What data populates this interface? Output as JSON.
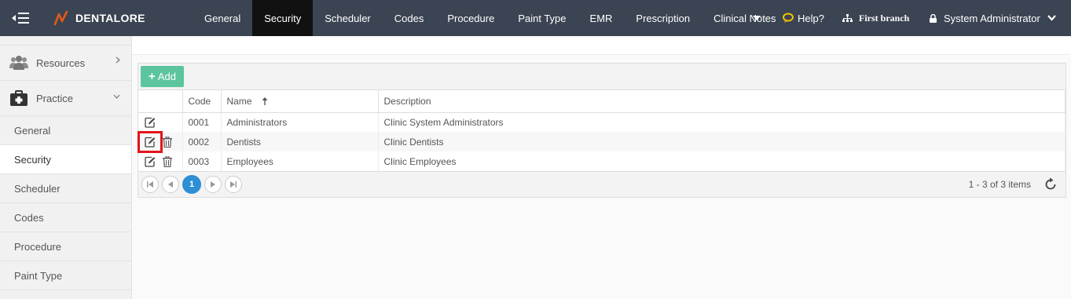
{
  "app": {
    "name": "DENTALORE"
  },
  "nav": {
    "items": [
      "General",
      "Security",
      "Scheduler",
      "Codes",
      "Procedure",
      "Paint Type",
      "EMR",
      "Prescription",
      "Clinical Notes"
    ],
    "active": "Security",
    "help": "Help?",
    "branch": "First branch",
    "user": "System Administrator"
  },
  "sidebar": {
    "groups": [
      {
        "label": "Resources",
        "icon": "users-icon"
      },
      {
        "label": "Practice",
        "icon": "medical-kit-icon"
      }
    ],
    "items": [
      "General",
      "Security",
      "Scheduler",
      "Codes",
      "Procedure",
      "Paint Type"
    ],
    "active": "Security"
  },
  "grid": {
    "add_label": "Add",
    "columns": {
      "code": "Code",
      "name": "Name",
      "description": "Description"
    },
    "rows": [
      {
        "code": "0001",
        "name": "Administrators",
        "description": "Clinic System Administrators"
      },
      {
        "code": "0002",
        "name": "Dentists",
        "description": "Clinic Dentists"
      },
      {
        "code": "0003",
        "name": "Employees",
        "description": "Clinic Employees"
      }
    ],
    "pager": {
      "current_page": "1",
      "info": "1 - 3 of 3 items"
    }
  },
  "colors": {
    "topbar": "#3b4452",
    "active_nav": "#111111",
    "add_button": "#5cc59d",
    "page_button": "#2d8fd6",
    "highlight": "#e3141b",
    "logo_accent": "#e05a1b"
  }
}
